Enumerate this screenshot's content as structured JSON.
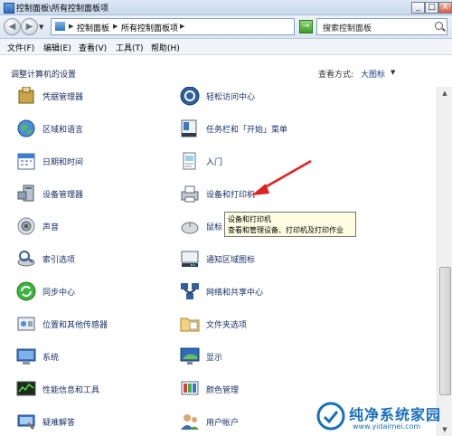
{
  "window": {
    "title": "控制面板\\所有控制面板项",
    "minimize": "_",
    "maximize": "□",
    "close": "X"
  },
  "address": {
    "crumbs": [
      "控制面板",
      "所有控制面板项"
    ],
    "go": "→",
    "search_placeholder": "搜索控制面板"
  },
  "menu": [
    "文件(F)",
    "编辑(E)",
    "查看(V)",
    "工具(T)",
    "帮助(H)"
  ],
  "content": {
    "heading": "调整计算机的设置",
    "view_by_label": "查看方式:",
    "view_by_value": "大图标"
  },
  "items_left": [
    {
      "label": "凭据管理器",
      "icon": "credential-icon"
    },
    {
      "label": "区域和语言",
      "icon": "globe-icon"
    },
    {
      "label": "日期和时间",
      "icon": "calendar-icon"
    },
    {
      "label": "设备管理器",
      "icon": "device-manager-icon"
    },
    {
      "label": "声音",
      "icon": "speaker-icon"
    },
    {
      "label": "索引选项",
      "icon": "index-icon"
    },
    {
      "label": "同步中心",
      "icon": "sync-icon"
    },
    {
      "label": "位置和其他传感器",
      "icon": "sensor-icon"
    },
    {
      "label": "系统",
      "icon": "system-icon"
    },
    {
      "label": "性能信息和工具",
      "icon": "performance-icon"
    },
    {
      "label": "疑难解答",
      "icon": "troubleshoot-icon"
    }
  ],
  "items_right": [
    {
      "label": "轻松访问中心",
      "icon": "accessibility-icon"
    },
    {
      "label": "任务栏和「开始」菜单",
      "icon": "taskbar-icon"
    },
    {
      "label": "入门",
      "icon": "getting-started-icon"
    },
    {
      "label": "设备和打印机",
      "icon": "printer-icon"
    },
    {
      "label": "鼠标",
      "icon": "mouse-icon"
    },
    {
      "label": "通知区域图标",
      "icon": "notification-icon"
    },
    {
      "label": "网络和共享中心",
      "icon": "network-icon"
    },
    {
      "label": "文件夹选项",
      "icon": "folder-icon"
    },
    {
      "label": "显示",
      "icon": "display-icon"
    },
    {
      "label": "颜色管理",
      "icon": "color-icon"
    },
    {
      "label": "用户帐户",
      "icon": "user-accounts-icon"
    }
  ],
  "tooltip": {
    "title": "设备和打印机",
    "desc": "查看和管理设备、打印机及打印作业"
  },
  "watermark": {
    "title": "纯净系统家园",
    "url": "www.yidaimei.com"
  },
  "colors": {
    "link": "#1a3066",
    "annotation_arrow": "#e02020",
    "tooltip_bg": "#fffde1"
  }
}
